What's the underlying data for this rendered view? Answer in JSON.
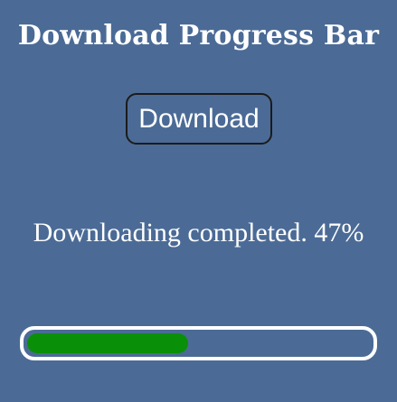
{
  "header": {
    "title": "Download Progress Bar"
  },
  "controls": {
    "download_label": "Download"
  },
  "status": {
    "text": "Downloading completed. 47%"
  },
  "progress": {
    "percent": 47
  },
  "colors": {
    "background": "#4b6b96",
    "fill": "#0a8f08",
    "track_border": "#ffffff",
    "button_border": "#1b1b1b"
  }
}
